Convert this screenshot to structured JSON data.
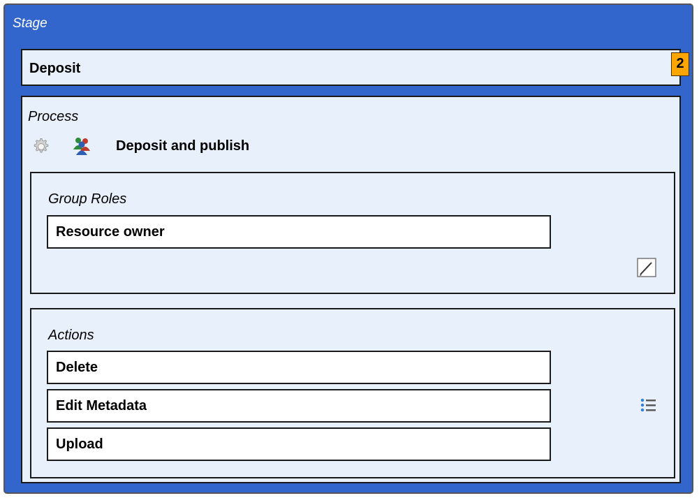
{
  "stage": {
    "title": "Stage",
    "name": "Deposit",
    "order_badge": "2"
  },
  "process": {
    "title": "Process",
    "name": "Deposit and publish",
    "icons": [
      "gear-icon",
      "group-users-icon"
    ]
  },
  "group_roles": {
    "title": "Group Roles",
    "items": [
      "Resource owner"
    ],
    "edit_icon": "edit-pencil-icon"
  },
  "actions": {
    "title": "Actions",
    "items": [
      "Delete",
      "Edit Metadata",
      "Upload"
    ],
    "list_icon": "list-icon"
  },
  "colors": {
    "stage_bg": "#3366cc",
    "panel_bg": "#e8f0fb",
    "badge_bg": "#ffa500"
  }
}
